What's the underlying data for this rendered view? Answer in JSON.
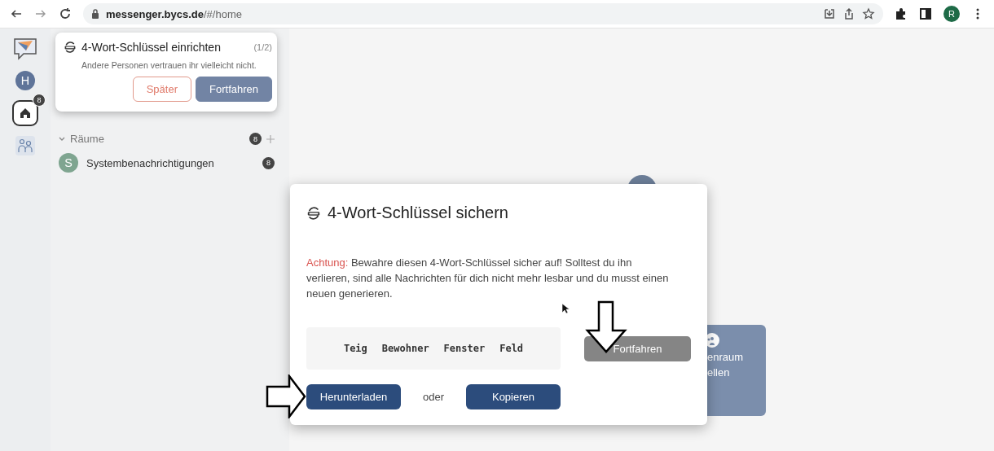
{
  "browser": {
    "url": "**messenger.bycs.de**/#/home",
    "profile_initial": "R"
  },
  "rail": {
    "avatar_initial": "H",
    "home_badge": "8"
  },
  "sidebar": {
    "sections": [
      {
        "title": "Räume",
        "count": "8",
        "expanded": true,
        "items": [
          {
            "initial": "S",
            "name": "Systembenachrichtigungen",
            "count": "8"
          }
        ]
      }
    ]
  },
  "popover": {
    "title": "4-Wort-Schlüssel einrichten",
    "step": "(1/2)",
    "message": "Andere Personen vertrauen ihr vielleicht nicht.",
    "buttons": [
      {
        "label": "Später",
        "kind": "outline"
      },
      {
        "label": "Fortfahren",
        "kind": "primary"
      }
    ]
  },
  "background_tile": {
    "lines": [
      "enraum",
      "ellen"
    ]
  },
  "dialog": {
    "title": "4-Wort-Schlüssel sichern",
    "warning_label": "Achtung:",
    "warning_text": "Bewahre diesen 4-Wort-Schlüssel sicher auf! Solltest du ihn verlieren, sind alle Nachrichten für dich nicht mehr lesbar und du musst einen neuen generieren.",
    "key_words": [
      "Teig",
      "Bewohner",
      "Fenster",
      "Feld"
    ],
    "continue_button": {
      "label": "Fortfahren",
      "disabled": true
    },
    "actions": [
      {
        "label": "Herunterladen"
      },
      {
        "label": "Kopieren"
      }
    ],
    "separator": "oder"
  }
}
